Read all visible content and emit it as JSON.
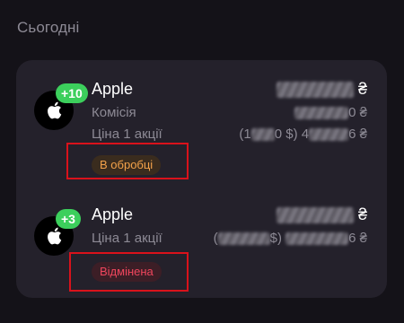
{
  "section": {
    "title": "Сьогодні"
  },
  "transactions": [
    {
      "name": "Apple",
      "qty_badge": "+10",
      "currency_symbol": "₴",
      "commission_label": "Комісія",
      "price_label": "Ціна 1 акції",
      "price_prefix": "(1",
      "price_mid": "0 $)",
      "price_suffix": "4",
      "price_end": "6 ₴",
      "commission_end": "0 ₴",
      "status": "В обробці",
      "status_color": "#f3a24a"
    },
    {
      "name": "Apple",
      "qty_badge": "+3",
      "currency_symbol": "₴",
      "price_label": "Ціна 1 акції",
      "price_prefix": "(",
      "price_mid": "$)",
      "price_end": "6 ₴",
      "status": "Відмінена",
      "status_color": "#f0465d"
    }
  ],
  "icons": {
    "company_logo": "apple-logo-icon"
  },
  "colors": {
    "background": "#141218",
    "card": "#24212b",
    "badge_green": "#3ccf5c",
    "highlight_red": "#d9121b"
  }
}
